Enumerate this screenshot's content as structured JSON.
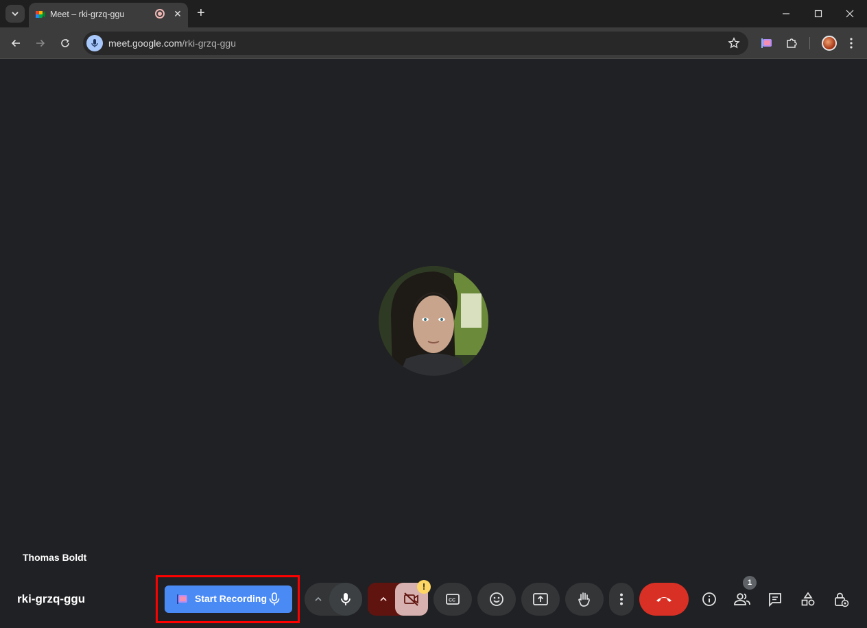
{
  "browser": {
    "tab": {
      "title": "Meet – rki-grzq-ggu",
      "close_glyph": "✕"
    },
    "new_tab_glyph": "+",
    "url": {
      "host": "meet.google.com",
      "path": "/rki-grzq-ggu"
    }
  },
  "meet": {
    "participant_name": "Thomas Boldt",
    "meeting_code": "rki-grzq-ggu",
    "record_button_label": "Start Recording",
    "camera_warning": "!",
    "people_count": "1"
  },
  "colors": {
    "stage_bg": "#202124",
    "record_button": "#4a8af4",
    "highlight": "#ff0000",
    "end_call": "#d93025",
    "camera_off": "#f9dedc"
  },
  "icons": [
    "tab-search-icon",
    "meet-favicon-icon",
    "recording-indicator-icon",
    "close-icon",
    "new-tab-icon",
    "minimize-icon",
    "maximize-icon",
    "window-close-icon",
    "back-icon",
    "forward-icon",
    "reload-icon",
    "voice-search-icon",
    "bookmark-star-icon",
    "extension-flag-icon",
    "puzzle-icon",
    "profile-avatar",
    "kebab-menu-icon",
    "mic-icon",
    "camera-off-icon",
    "captions-icon",
    "emoji-icon",
    "present-icon",
    "raise-hand-icon",
    "more-options-icon",
    "end-call-icon",
    "info-icon",
    "people-icon",
    "chat-icon",
    "activities-icon",
    "host-controls-icon"
  ]
}
